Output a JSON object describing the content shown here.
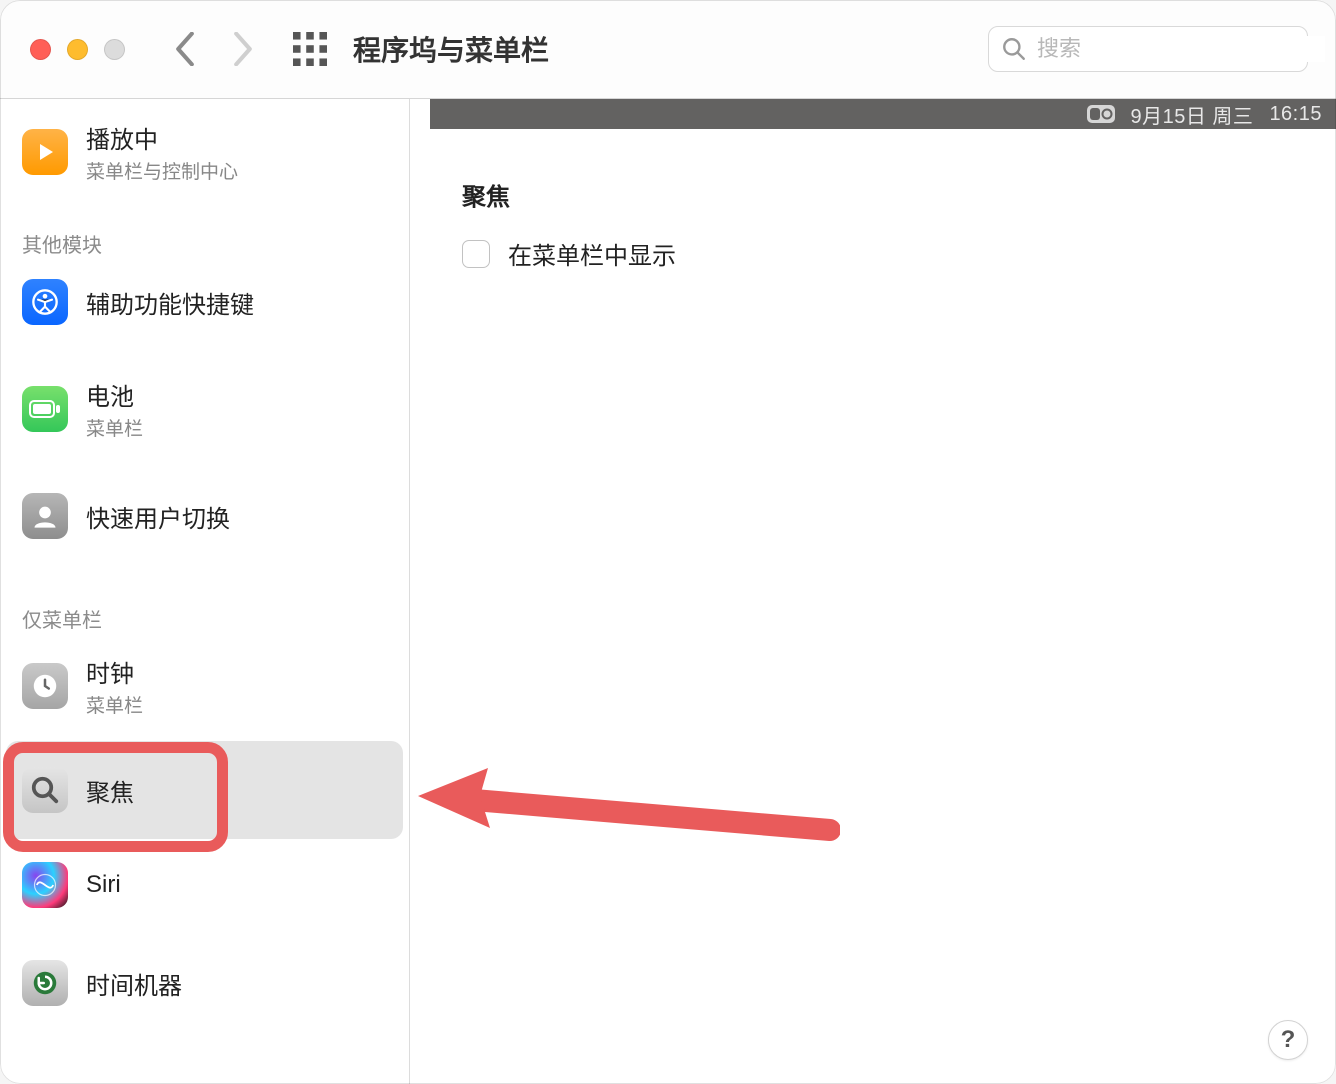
{
  "titlebar": {
    "title": "程序坞与菜单栏",
    "search_placeholder": "搜索"
  },
  "sidebar": {
    "sections": {
      "s0": {
        "header": null
      },
      "s1": {
        "header": "其他模块"
      },
      "s2": {
        "header": "仅菜单栏"
      }
    },
    "items": {
      "now_playing": {
        "label": "播放中",
        "sublabel": "菜单栏与控制中心"
      },
      "a11y": {
        "label": "辅助功能快捷键",
        "sublabel": null
      },
      "battery": {
        "label": "电池",
        "sublabel": "菜单栏"
      },
      "fast_user": {
        "label": "快速用户切换",
        "sublabel": null
      },
      "clock": {
        "label": "时钟",
        "sublabel": "菜单栏"
      },
      "spotlight": {
        "label": "聚焦",
        "sublabel": null
      },
      "siri": {
        "label": "Siri",
        "sublabel": null
      },
      "time_machine": {
        "label": "时间机器",
        "sublabel": null
      }
    },
    "selected": "spotlight"
  },
  "content": {
    "menubar_preview": {
      "date": "9月15日 周三",
      "time": "16:15"
    },
    "panel_title": "聚焦",
    "checkbox_label": "在菜单栏中显示",
    "checkbox_checked": false
  },
  "help_label": "?"
}
